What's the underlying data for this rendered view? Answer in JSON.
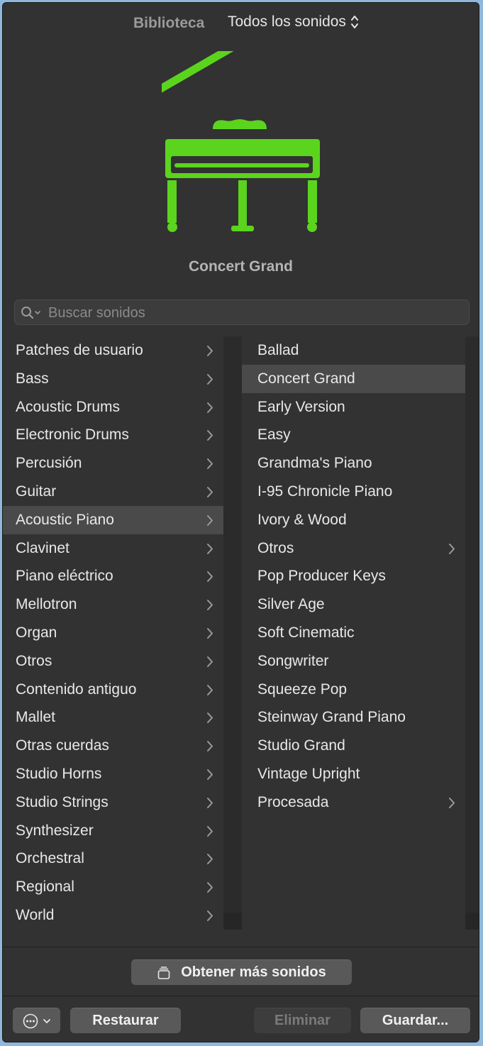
{
  "header": {
    "library_label": "Biblioteca",
    "sound_filter": "Todos los sonidos"
  },
  "patch": {
    "name": "Concert Grand",
    "icon": "grand-piano-icon",
    "icon_color": "#5bd41d"
  },
  "search": {
    "placeholder": "Buscar sonidos",
    "value": ""
  },
  "categories": [
    {
      "label": "Patches de usuario"
    },
    {
      "label": "Bass"
    },
    {
      "label": "Acoustic Drums"
    },
    {
      "label": "Electronic Drums"
    },
    {
      "label": "Percusión"
    },
    {
      "label": "Guitar"
    },
    {
      "label": "Acoustic Piano",
      "selected": true
    },
    {
      "label": "Clavinet"
    },
    {
      "label": "Piano eléctrico"
    },
    {
      "label": "Mellotron"
    },
    {
      "label": "Organ"
    },
    {
      "label": "Otros"
    },
    {
      "label": "Contenido antiguo"
    },
    {
      "label": "Mallet"
    },
    {
      "label": "Otras cuerdas"
    },
    {
      "label": "Studio Horns"
    },
    {
      "label": "Studio Strings"
    },
    {
      "label": "Synthesizer"
    },
    {
      "label": "Orchestral"
    },
    {
      "label": "Regional"
    },
    {
      "label": "World"
    }
  ],
  "patches": [
    {
      "label": "Ballad",
      "submenu": false
    },
    {
      "label": "Concert Grand",
      "submenu": false,
      "selected": true
    },
    {
      "label": "Early Version",
      "submenu": false
    },
    {
      "label": "Easy",
      "submenu": false
    },
    {
      "label": "Grandma's Piano",
      "submenu": false
    },
    {
      "label": "I-95 Chronicle Piano",
      "submenu": false
    },
    {
      "label": "Ivory & Wood",
      "submenu": false
    },
    {
      "label": "Otros",
      "submenu": true
    },
    {
      "label": "Pop Producer Keys",
      "submenu": false
    },
    {
      "label": "Silver Age",
      "submenu": false
    },
    {
      "label": "Soft Cinematic",
      "submenu": false
    },
    {
      "label": "Songwriter",
      "submenu": false
    },
    {
      "label": "Squeeze Pop",
      "submenu": false
    },
    {
      "label": "Steinway Grand Piano",
      "submenu": false
    },
    {
      "label": "Studio Grand",
      "submenu": false
    },
    {
      "label": "Vintage Upright",
      "submenu": false
    },
    {
      "label": "Procesada",
      "submenu": true
    }
  ],
  "footer": {
    "more_sounds_label": "Obtener más sonidos",
    "restore_label": "Restaurar",
    "delete_label": "Eliminar",
    "save_label": "Guardar..."
  }
}
